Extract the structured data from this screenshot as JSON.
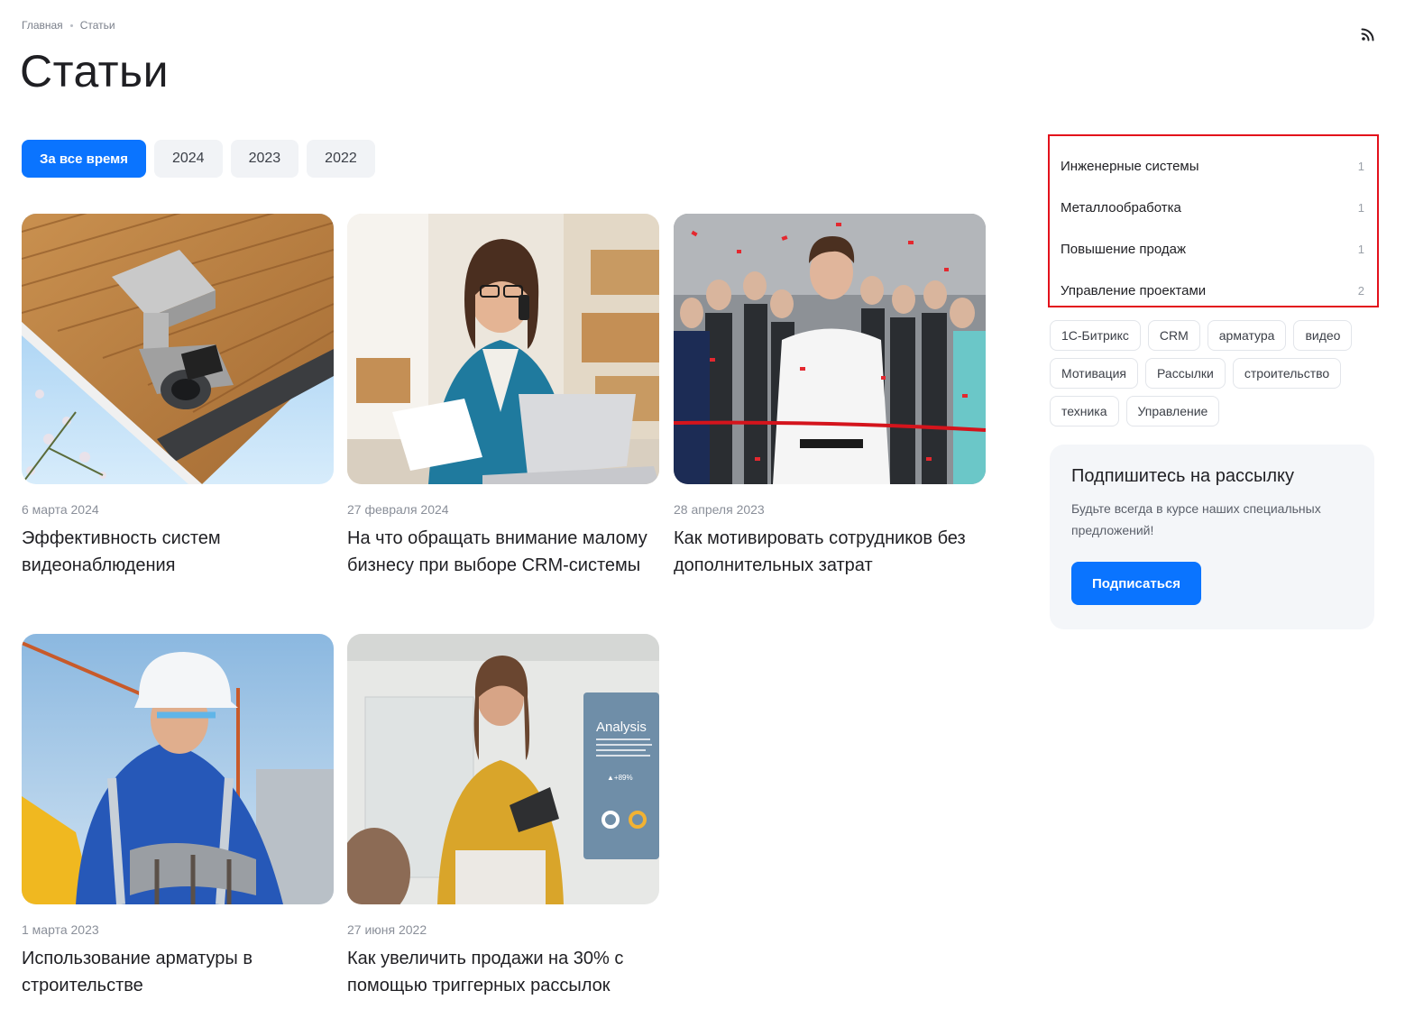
{
  "breadcrumb": {
    "home": "Главная",
    "current": "Статьи"
  },
  "page_title": "Статьи",
  "filters": [
    "За все время",
    "2024",
    "2023",
    "2022"
  ],
  "articles": [
    {
      "date": "6 марта 2024",
      "title": "Эффективность систем видеонаблюдения",
      "image": "security-camera"
    },
    {
      "date": "27 февраля 2024",
      "title": "На что обращать внимание малому бизнесу при выборе CRM-системы",
      "image": "woman-laptop"
    },
    {
      "date": "28 апреля 2023",
      "title": "Как мотивировать сотрудников без дополнительных затрат",
      "image": "ribbon-cutting"
    },
    {
      "date": "1 марта 2023",
      "title": "Использование арматуры в строительстве",
      "image": "construction-worker"
    },
    {
      "date": "27 июня 2022",
      "title": "Как увеличить продажи на 30% с помощью триггерных рассылок",
      "image": "woman-presentation"
    }
  ],
  "presentation_screen": {
    "heading": "Analysis",
    "stat": "▲+89%"
  },
  "categories": [
    {
      "label": "Инженерные системы",
      "count": "1"
    },
    {
      "label": "Металлообработка",
      "count": "1"
    },
    {
      "label": "Повышение продаж",
      "count": "1"
    },
    {
      "label": "Управление проектами",
      "count": "2"
    }
  ],
  "tags": [
    "1С-Битрикс",
    "CRM",
    "арматура",
    "видео",
    "Мотивация",
    "Рассылки",
    "строительство",
    "техника",
    "Управление"
  ],
  "subscribe": {
    "title": "Подпишитесь на рассылку",
    "text": "Будьте всегда в курсе наших специальных предложений!",
    "button": "Подписаться"
  },
  "colors": {
    "accent": "#0a74ff",
    "highlight_border": "#e3111b",
    "panel": "#f4f6f9"
  }
}
